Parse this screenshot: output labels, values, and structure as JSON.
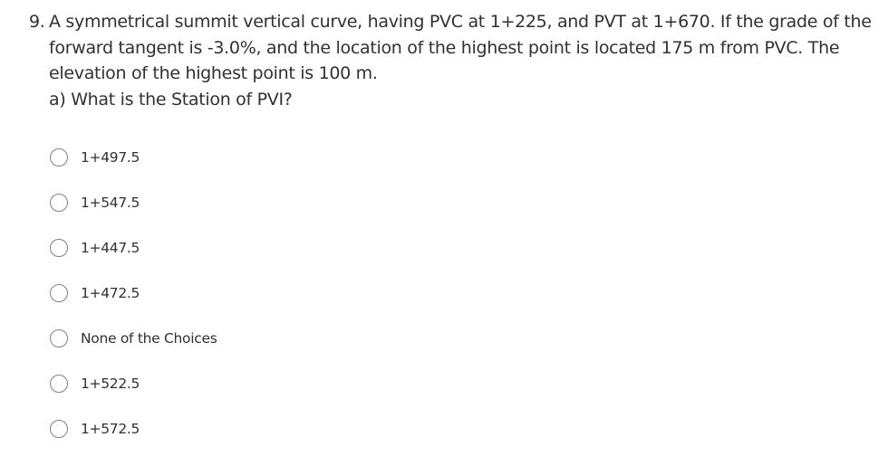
{
  "question": {
    "number": "9.",
    "lines": [
      "A symmetrical summit vertical curve, having PVC at 1+225, and PVT at 1+670. If the grade of the",
      "forward tangent is -3.0%, and the location of the highest point is located 175 m from PVC. The",
      "elevation of the highest point is 100 m.",
      "a) What is the Station of PVI?"
    ]
  },
  "options": [
    {
      "label": "1+497.5",
      "selected": false
    },
    {
      "label": "1+547.5",
      "selected": false
    },
    {
      "label": "1+447.5",
      "selected": false
    },
    {
      "label": "1+472.5",
      "selected": false
    },
    {
      "label": "None of the Choices",
      "selected": false
    },
    {
      "label": "1+522.5",
      "selected": false
    },
    {
      "label": "1+572.5",
      "selected": false
    }
  ]
}
